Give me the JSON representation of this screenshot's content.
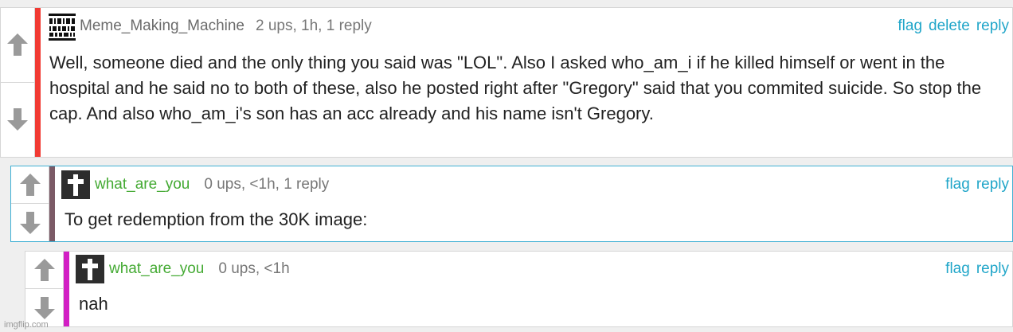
{
  "comments": [
    {
      "username": "Meme_Making_Machine",
      "stats": "2 ups, 1h, 1 reply",
      "body": "Well, someone died and the only thing you said was \"LOL\". Also I asked who_am_i if he killed himself or went in the hospital and he said no to both of these, also he posted right after \"Gregory\" said that you commited suicide. So stop the cap. And also who_am_i's son has an acc already and his name isn't Gregory.",
      "actions": {
        "flag": "flag",
        "delete": "delete",
        "reply": "reply"
      },
      "bar_color": "#f13a33",
      "avatar_icon": "qr-pattern-icon"
    },
    {
      "username": "what_are_you",
      "stats": "0 ups, <1h, 1 reply",
      "body": "To get redemption from the 30K image:",
      "actions": {
        "flag": "flag",
        "reply": "reply"
      },
      "bar_color": "#7b5a66",
      "avatar_icon": "cross-icon"
    },
    {
      "username": "what_are_you",
      "stats": "0 ups, <1h",
      "body": "nah",
      "actions": {
        "flag": "flag",
        "reply": "reply"
      },
      "bar_color": "#d21fc4",
      "avatar_icon": "cross-icon"
    }
  ],
  "colors": {
    "link": "#21a6c9",
    "username_green": "#44aa33",
    "username_gray": "#6b6b6b",
    "arrow_gray": "#9a9a9a"
  },
  "watermark": "imgflip.com"
}
